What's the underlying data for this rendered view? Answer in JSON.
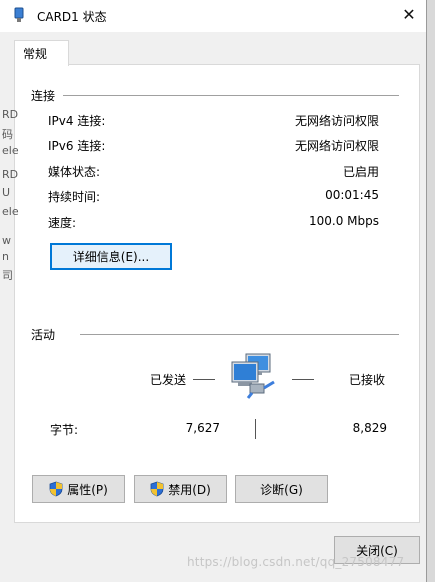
{
  "window": {
    "title": "CARD1 状态",
    "close_glyph": "✕"
  },
  "tabs": [
    {
      "label": "常规"
    }
  ],
  "connection": {
    "heading": "连接",
    "rows": [
      {
        "label": "IPv4 连接:",
        "value": "无网络访问权限"
      },
      {
        "label": "IPv6 连接:",
        "value": "无网络访问权限"
      },
      {
        "label": "媒体状态:",
        "value": "已启用"
      },
      {
        "label": "持续时间:",
        "value": "00:01:45"
      },
      {
        "label": "速度:",
        "value": "100.0 Mbps"
      }
    ],
    "details_button": "详细信息(E)..."
  },
  "activity": {
    "heading": "活动",
    "sent_label": "已发送",
    "received_label": "已接收",
    "bytes_label": "字节:",
    "bytes_sent": "7,627",
    "bytes_received": "8,829",
    "icon": "network-computers-icon"
  },
  "buttons": {
    "properties": "属性(P)",
    "disable": "禁用(D)",
    "diagnose": "诊断(G)",
    "close": "关闭(C)"
  },
  "watermark": "https://blog.csdn.net/qq_27508477",
  "background_fragments": [
    "RD",
    "码",
    "ele",
    "RD",
    "U",
    "ele",
    "w",
    "n",
    "司"
  ],
  "colors": {
    "accent": "#0078d7",
    "panel": "#ffffff",
    "dialog": "#f0f0f0",
    "shield_blue": "#2b6fd6",
    "shield_yellow": "#f2c230"
  }
}
